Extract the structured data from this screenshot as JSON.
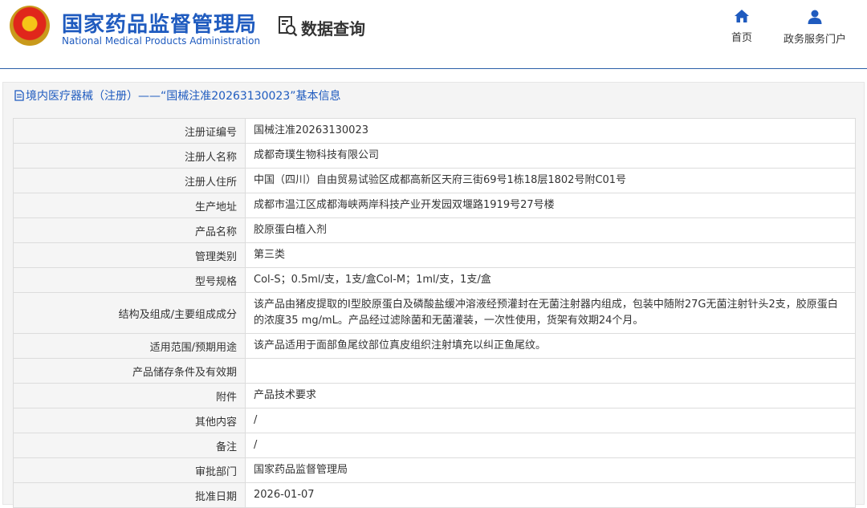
{
  "header": {
    "agency_cn": "国家药品监督管理局",
    "agency_en": "National Medical Products Administration",
    "module_title": "数据查询",
    "nav": [
      {
        "label": "首页",
        "icon": "home-icon"
      },
      {
        "label": "政务服务门户",
        "icon": "user-icon"
      }
    ]
  },
  "panel": {
    "title": "境内医疗器械（注册）——“国械注准20263130023”基本信息",
    "icon": "document-icon"
  },
  "rows": [
    {
      "label": "注册证编号",
      "value": "国械注准20263130023"
    },
    {
      "label": "注册人名称",
      "value": "成都奇璞生物科技有限公司"
    },
    {
      "label": "注册人住所",
      "value": "中国（四川）自由贸易试验区成都高新区天府三街69号1栋18层1802号附C01号"
    },
    {
      "label": "生产地址",
      "value": "成都市温江区成都海峡两岸科技产业开发园双堰路1919号27号楼"
    },
    {
      "label": "产品名称",
      "value": "胶原蛋白植入剂"
    },
    {
      "label": "管理类别",
      "value": "第三类"
    },
    {
      "label": "型号规格",
      "value": "Col-S；0.5ml/支，1支/盒Col-M；1ml/支，1支/盒"
    },
    {
      "label": "结构及组成/主要组成成分",
      "value": "该产品由猪皮提取的Ⅰ型胶原蛋白及磷酸盐缓冲溶液经预灌封在无菌注射器内组成，包装中随附27G无菌注射针头2支，胶原蛋白的浓度35 mg/mL。产品经过滤除菌和无菌灌装，一次性使用，货架有效期24个月。"
    },
    {
      "label": "适用范围/预期用途",
      "value": "该产品适用于面部鱼尾纹部位真皮组织注射填充以纠正鱼尾纹。"
    },
    {
      "label": "产品储存条件及有效期",
      "value": ""
    },
    {
      "label": "附件",
      "value": "产品技术要求"
    },
    {
      "label": "其他内容",
      "value": "/"
    },
    {
      "label": "备注",
      "value": "/"
    },
    {
      "label": "审批部门",
      "value": "国家药品监督管理局"
    },
    {
      "label": "批准日期",
      "value": "2026-01-07"
    }
  ]
}
